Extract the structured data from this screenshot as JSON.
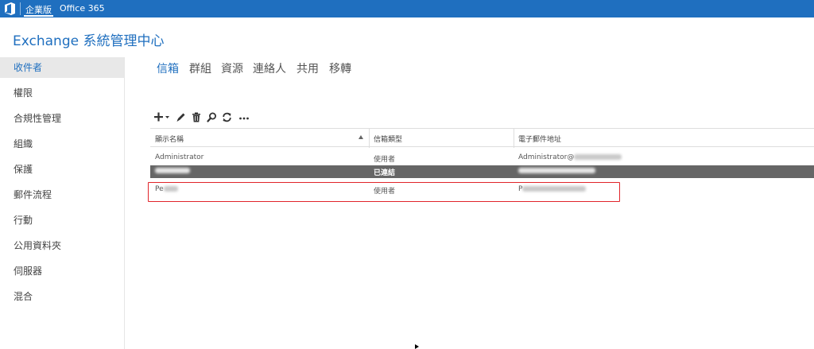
{
  "topbar": {
    "edition_label": "企業版",
    "product_label": "Office 365",
    "bar_color": "#1f6fbf"
  },
  "app_title": "Exchange 系統管理中心",
  "sidebar": {
    "items": [
      {
        "label": "收件者",
        "active": true
      },
      {
        "label": "權限"
      },
      {
        "label": "合規性管理"
      },
      {
        "label": "組織"
      },
      {
        "label": "保護"
      },
      {
        "label": "郵件流程"
      },
      {
        "label": "行動"
      },
      {
        "label": "公用資料夾"
      },
      {
        "label": "伺服器"
      },
      {
        "label": "混合"
      }
    ]
  },
  "tabs": [
    {
      "label": "信箱",
      "active": true
    },
    {
      "label": "群組"
    },
    {
      "label": "資源"
    },
    {
      "label": "連絡人"
    },
    {
      "label": "共用"
    },
    {
      "label": "移轉"
    }
  ],
  "toolbar": {
    "icons": [
      "add-icon",
      "edit-icon",
      "delete-icon",
      "search-icon",
      "refresh-icon",
      "more-icon"
    ]
  },
  "table": {
    "columns": [
      "顯示名稱",
      "信箱類型",
      "電子郵件地址"
    ],
    "sorted_column": "顯示名稱",
    "rows": [
      {
        "name": "Administrator",
        "type": "使用者",
        "email": "Administrator@",
        "selected": false
      },
      {
        "name": "",
        "type": "已連結",
        "email": "",
        "selected": true
      },
      {
        "name": "Pe",
        "type": "使用者",
        "email": "P",
        "selected": false,
        "highlighted": true
      }
    ]
  },
  "colors": {
    "accent": "#1f6fbf",
    "selected_row": "#666666",
    "highlight_border": "#e1242a"
  }
}
